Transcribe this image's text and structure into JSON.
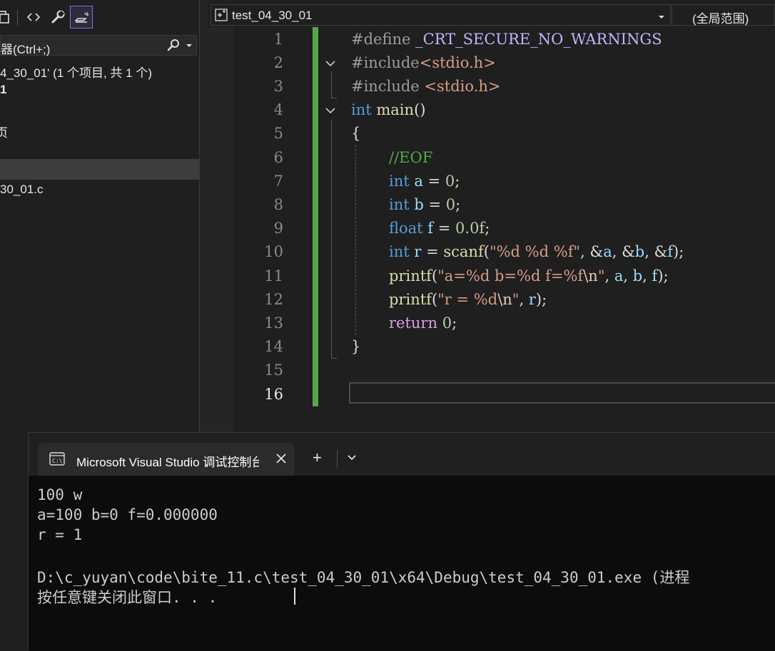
{
  "solution_explorer": {
    "search_placeholder": "器(Ctrl+;)",
    "solution_label": "4_30_01' (1 个项目, 共 1 个)",
    "project_label": "1",
    "item_label": "页",
    "file_label": "30_01.c"
  },
  "editor": {
    "file_dropdown": "test_04_30_01",
    "scope_dropdown": "(全局范围)",
    "line_numbers": [
      "1",
      "2",
      "3",
      "4",
      "5",
      "6",
      "7",
      "8",
      "9",
      "10",
      "11",
      "12",
      "13",
      "14",
      "15",
      "16"
    ],
    "current_line": "16",
    "code_lines": [
      "#define _CRT_SECURE_NO_WARNINGS",
      "#include<stdio.h>",
      "#include <stdio.h>",
      "int main()",
      "{",
      "//EOF",
      "int a = 0;",
      "int b = 0;",
      "float f = 0.0f;",
      "int r = scanf(\"%d %d %f\", &a, &b, &f);",
      "printf(\"a=%d b=%d f=%f\\n\", a, b, f);",
      "printf(\"r = %d\\n\", r);",
      "return 0;",
      "}",
      "",
      ""
    ]
  },
  "terminal": {
    "tab_title": "Microsoft Visual Studio 调试控制台",
    "new_tab": "+",
    "output": [
      "100 w",
      "a=100 b=0 f=0.000000",
      "r = 1",
      "",
      "D:\\c_yuyan\\code\\bite_11.c\\test_04_30_01\\x64\\Debug\\test_04_30_01.exe (进程",
      "按任意键关闭此窗口. . ."
    ]
  },
  "colors": {
    "keyword": "#569cd6",
    "string": "#d69d85",
    "comment": "#57a64a",
    "number": "#b5cea8",
    "variable": "#9cdcfe",
    "function": "#dcdcaa",
    "macro": "#beb7ff",
    "control": "#d8a0df",
    "change_bar": "#57a64a",
    "active_border": "#7b6ff0"
  }
}
